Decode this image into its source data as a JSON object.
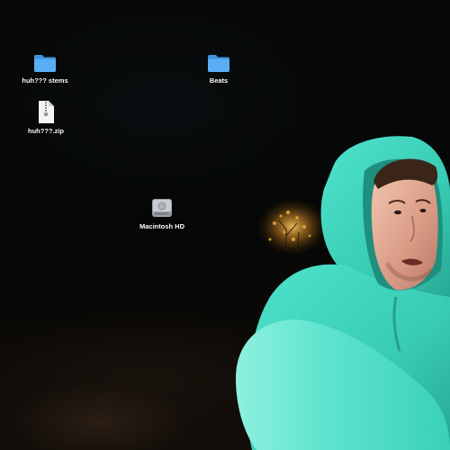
{
  "desktop": {
    "icons": [
      {
        "label": "huh??? stems",
        "icon": "folder-icon",
        "color": "#5aaef5"
      },
      {
        "label": "Beats",
        "icon": "folder-icon",
        "color": "#5aaef5"
      },
      {
        "label": "huh???.zip",
        "icon": "zip-archive-icon"
      },
      {
        "label": "Macintosh HD",
        "icon": "hard-drive-icon"
      }
    ]
  },
  "wallpaper": {
    "subject": "person-in-hoodie-photo",
    "hoodie_color": "#3fd8c0",
    "background_color": "#050606"
  }
}
